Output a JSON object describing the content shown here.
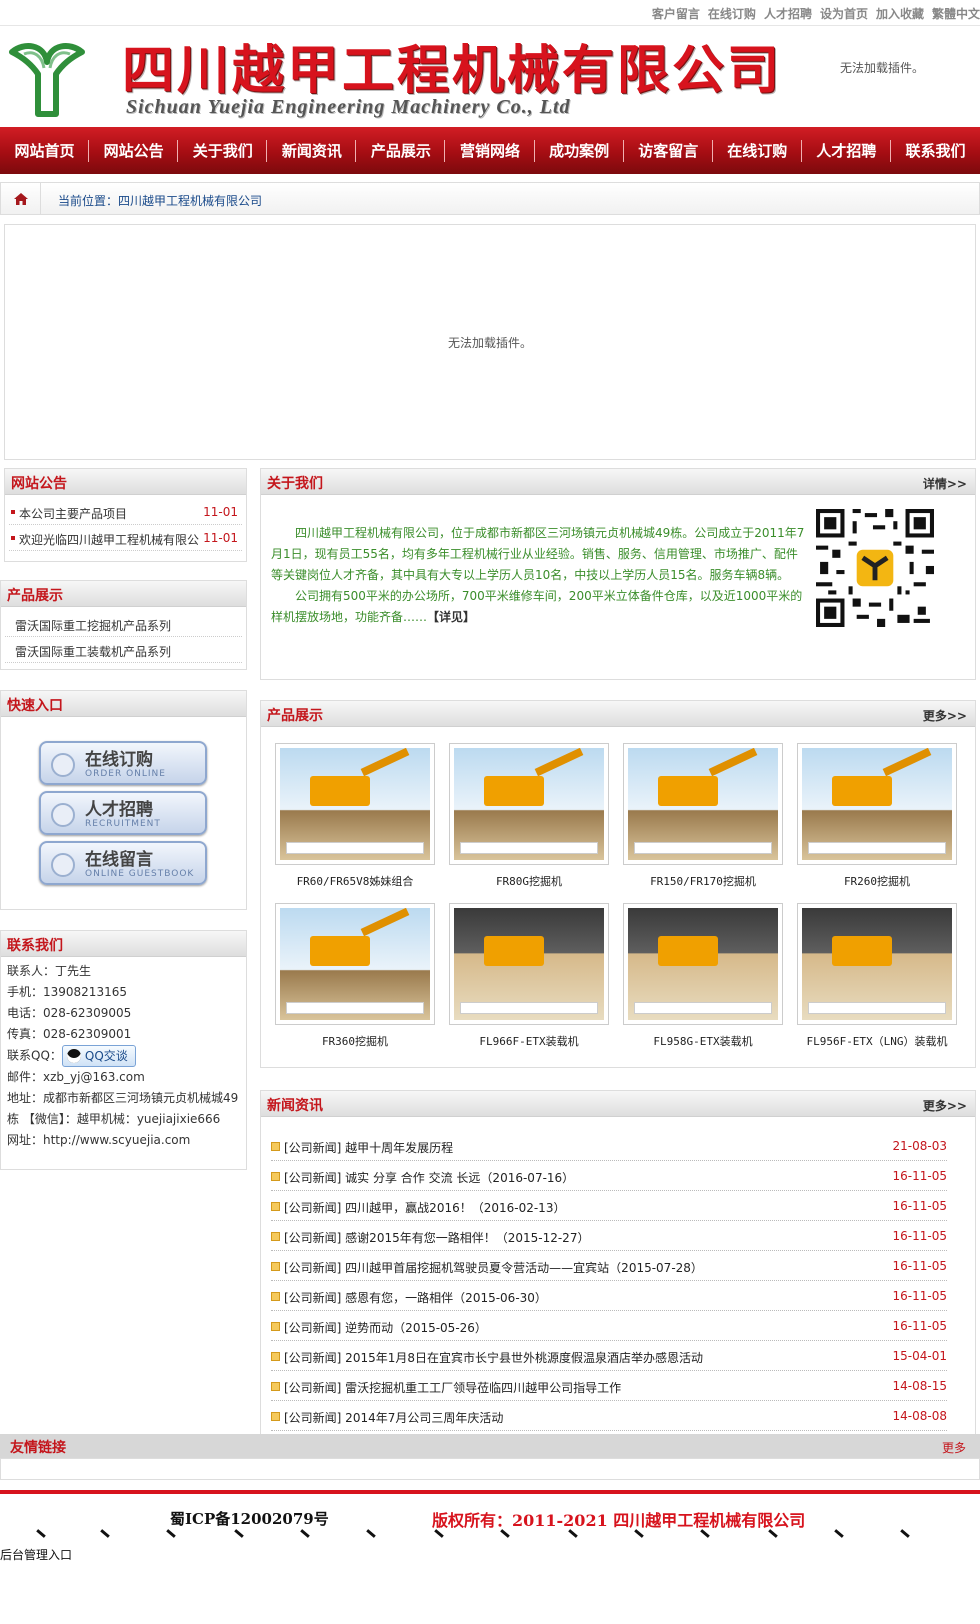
{
  "top_links": [
    "客户留言",
    "在线订购",
    "人才招聘",
    "设为首页",
    "加入收藏",
    "繁體中文"
  ],
  "header": {
    "company_cn": "四川越甲工程机械有限公司",
    "company_en": "Sichuan Yuejia Engineering Machinery Co., Ltd",
    "plugin_msg": "无法加载插件。"
  },
  "nav": [
    "网站首页",
    "网站公告",
    "关于我们",
    "新闻资讯",
    "产品展示",
    "营销网络",
    "成功案例",
    "访客留言",
    "在线订购",
    "人才招聘",
    "联系我们"
  ],
  "breadcrumb": {
    "label": "当前位置：",
    "value": "四川越甲工程机械有限公司"
  },
  "banner": {
    "msg": "无法加载插件。"
  },
  "notice": {
    "title": "网站公告",
    "items": [
      {
        "text": "本公司主要产品项目",
        "date": "11-01"
      },
      {
        "text": "欢迎光临四川越甲工程机械有限公",
        "date": "11-01"
      }
    ]
  },
  "side_products": {
    "title": "产品展示",
    "items": [
      "雷沃国际重工挖掘机产品系列",
      "雷沃国际重工装载机产品系列"
    ]
  },
  "quick": {
    "title": "快速入口",
    "buttons": [
      {
        "cn": "在线订购",
        "en": "ORDER ONLINE"
      },
      {
        "cn": "人才招聘",
        "en": "RECRUITMENT"
      },
      {
        "cn": "在线留言",
        "en": "ONLINE GUESTBOOK"
      }
    ]
  },
  "contact": {
    "title": "联系我们",
    "person": "联系人：丁先生",
    "mobile": "手机：13908213165",
    "phone": "电话：028-62309005",
    "fax": "传真：028-62309001",
    "qq_label": "联系QQ：",
    "qq_button": "QQ交谈",
    "email": "邮件：xzb_yj@163.com",
    "address": "地址：成都市新都区三河场镇元贞机械城49栋 【微信】：越甲机械：yuejiajixie666",
    "website": "网址：http://www.scyuejia.com"
  },
  "about": {
    "title": "关于我们",
    "more": "详情>>",
    "p1": "四川越甲工程机械有限公司，位于成都市新都区三河场镇元贞机械城49栋。公司成立于2011年7月1日，现有员工55名，均有多年工程机械行业从业经验。销售、服务、信用管理、市场推广、配件等关键岗位人才齐备，其中具有大专以上学历人员10名，中技以上学历人员15名。服务车辆8辆。",
    "p2": "公司拥有500平米的办公场所，700平米维修车间，200平米立体备件仓库，以及近1000平米的样机摆放场地，功能齐备……",
    "detail_link": "【详见】"
  },
  "products": {
    "title": "产品展示",
    "more": "更多>>",
    "items": [
      "FR60/FR65V8姊妹组合",
      "FR80G挖掘机",
      "FR150/FR170挖掘机",
      "FR260挖掘机",
      "FR360挖掘机",
      "FL966F-ETX装载机",
      "FL958G-ETX装载机",
      "FL956F-ETX（LNG）装载机"
    ]
  },
  "news": {
    "title": "新闻资讯",
    "more": "更多>>",
    "items": [
      {
        "text": "[公司新闻] 越甲十周年发展历程",
        "date": "21-08-03"
      },
      {
        "text": "[公司新闻] 诚实 分享 合作 交流 长远（2016-07-16）",
        "date": "16-11-05"
      },
      {
        "text": "[公司新闻] 四川越甲，赢战2016！（2016-02-13）",
        "date": "16-11-05"
      },
      {
        "text": "[公司新闻] 感谢2015年有您一路相伴！（2015-12-27）",
        "date": "16-11-05"
      },
      {
        "text": "[公司新闻] 四川越甲首届挖掘机驾驶员夏令营活动——宜宾站（2015-07-28）",
        "date": "16-11-05"
      },
      {
        "text": "[公司新闻] 感恩有您，一路相伴（2015-06-30）",
        "date": "16-11-05"
      },
      {
        "text": "[公司新闻] 逆势而动（2015-05-26）",
        "date": "16-11-05"
      },
      {
        "text": "[公司新闻] 2015年1月8日在宜宾市长宁县世外桃源度假温泉酒店举办感恩活动",
        "date": "15-04-01"
      },
      {
        "text": "[公司新闻] 雷沃挖掘机重工工厂领导莅临四川越甲公司指导工作",
        "date": "14-08-15"
      },
      {
        "text": "[公司新闻] 2014年7月公司三周年庆活动",
        "date": "14-08-08"
      }
    ]
  },
  "friend_links": {
    "title": "友情链接",
    "more": "更多"
  },
  "footer": {
    "icp": "蜀ICP备12002079号",
    "copyright": "版权所有：2011-2021 四川越甲工程机械有限公司",
    "admin": "后台管理入口"
  }
}
